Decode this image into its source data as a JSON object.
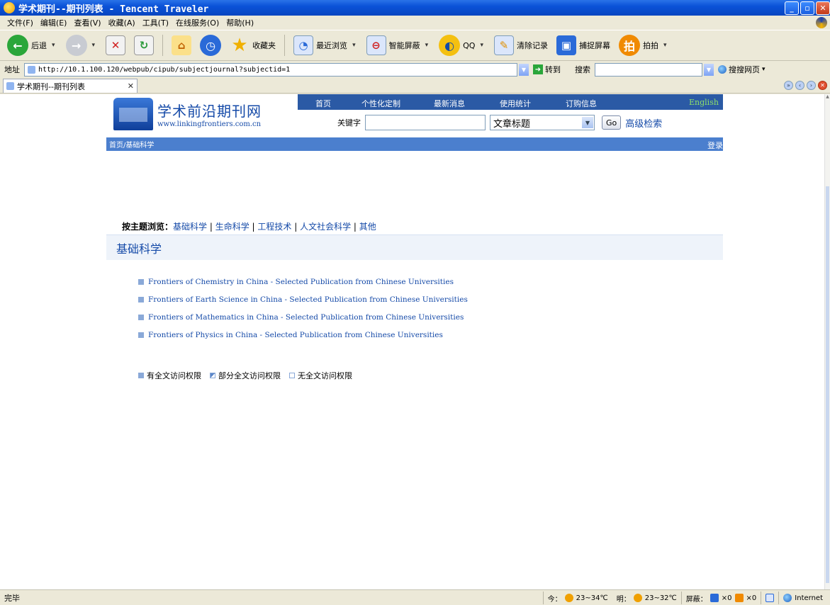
{
  "window": {
    "title": "学术期刊--期刊列表 - Tencent Traveler"
  },
  "menu": [
    "文件(F)",
    "编辑(E)",
    "查看(V)",
    "收藏(A)",
    "工具(T)",
    "在线服务(O)",
    "帮助(H)"
  ],
  "toolbar": {
    "back": "后退",
    "favorites": "收藏夹",
    "recent": "最近浏览",
    "popup_block": "智能屏蔽",
    "qq": "QQ",
    "clear": "清除记录",
    "capture": "捕捉屏幕",
    "paipai": "拍拍"
  },
  "address": {
    "label": "地址",
    "url": "http://10.1.100.120/webpub/cipub/subjectjournal?subjectid=1",
    "go": "转到",
    "search_label": "搜索",
    "search_engine": "搜搜网页"
  },
  "tab": {
    "title": "学术期刊--期刊列表"
  },
  "site": {
    "logo_name": "学术前沿期刊网",
    "logo_url": "www.linkingfrontiers.com.cn",
    "nav": [
      "首页",
      "个性化定制",
      "最新消息",
      "使用统计",
      "订购信息"
    ],
    "english": "English",
    "keyword_label": "关键字",
    "keyword_value": "",
    "field_select": "文章标题",
    "go_button": "Go",
    "advanced": "高级检索",
    "breadcrumb": "首页/基础科学",
    "login": "登录",
    "browse_label": "按主题浏览：",
    "topics": [
      "基础科学",
      "生命科学",
      "工程技术",
      "人文社会科学",
      "其他"
    ],
    "section_title": "基础科学",
    "journals": [
      "Frontiers of Chemistry in China - Selected Publication from Chinese Universities",
      "Frontiers of Earth Science in China - Selected Publication from Chinese Universities",
      "Frontiers of Mathematics in China - Selected Publication from Chinese Universities",
      "Frontiers of Physics in China - Selected Publication from Chinese Universities"
    ],
    "legend": [
      "有全文访问权限",
      "部分全文访问权限",
      "无全文访问权限"
    ]
  },
  "status": {
    "text": "完毕",
    "today": "今：",
    "today_temp": "23~34℃",
    "tomorrow": "明：",
    "tomorrow_temp": "23~32℃",
    "blocked": "屏蔽：",
    "count1": "×0",
    "count2": "×0",
    "zone": "Internet"
  },
  "colors": {
    "brand": "#154aa8",
    "nav": "#2b5aa5",
    "breadcrumb": "#4b7fce"
  }
}
